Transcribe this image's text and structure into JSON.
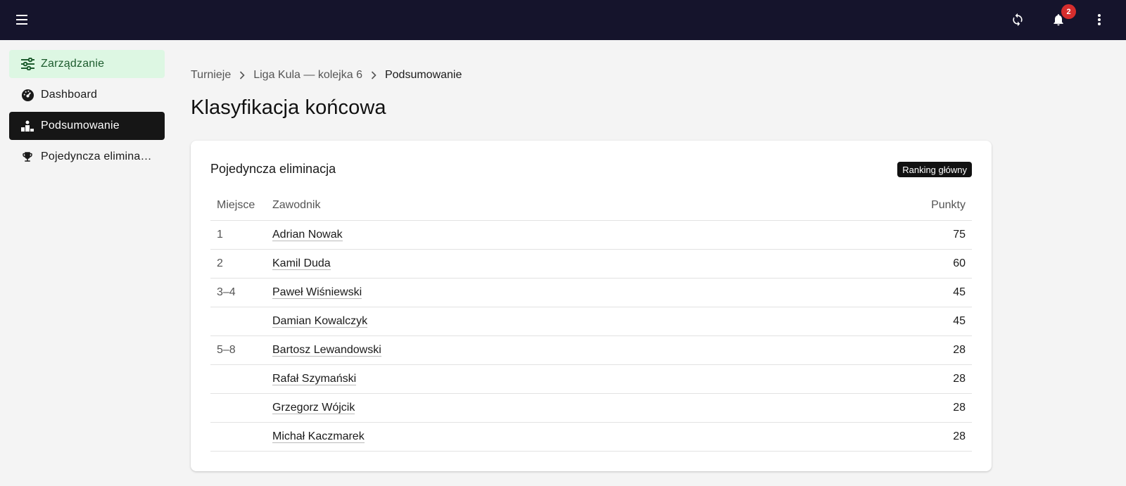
{
  "topbar": {
    "notification_count": "2",
    "icons": [
      "menu-icon",
      "refresh-icon",
      "bell-icon",
      "more-vert-icon"
    ]
  },
  "sidebar": {
    "items": [
      {
        "label": "Zarządzanie",
        "icon": "sliders-icon"
      },
      {
        "label": "Dashboard",
        "icon": "dashboard-icon"
      },
      {
        "label": "Podsumowanie",
        "icon": "podium-icon"
      },
      {
        "label": "Pojedyncza eliminacja",
        "icon": "trophy-icon"
      }
    ]
  },
  "breadcrumb": {
    "items": [
      "Turnieje",
      "Liga Kula — kolejka 6",
      "Podsumowanie"
    ]
  },
  "page_title": "Klasyfikacja końcowa",
  "card": {
    "title": "Pojedyncza eliminacja",
    "badge": "Ranking główny",
    "columns": [
      "Miejsce",
      "Zawodnik",
      "Punkty"
    ],
    "rows": [
      {
        "place": "1",
        "name": "Adrian Nowak",
        "points": "75"
      },
      {
        "place": "2",
        "name": "Kamil Duda",
        "points": "60"
      },
      {
        "place": "3–4",
        "name": "Paweł Wiśniewski",
        "points": "45"
      },
      {
        "place": "",
        "name": "Damian Kowalczyk",
        "points": "45"
      },
      {
        "place": "5–8",
        "name": "Bartosz Lewandowski",
        "points": "28"
      },
      {
        "place": "",
        "name": "Rafał Szymański",
        "points": "28"
      },
      {
        "place": "",
        "name": "Grzegorz Wójcik",
        "points": "28"
      },
      {
        "place": "",
        "name": "Michał Kaczmarek",
        "points": "28"
      }
    ]
  },
  "colors": {
    "topbar_bg": "#15142c",
    "accent_green_bg": "#ddf7e3",
    "accent_green_text": "#1d5c2e",
    "active_bg": "#161616",
    "badge_red": "#d62d2d"
  }
}
